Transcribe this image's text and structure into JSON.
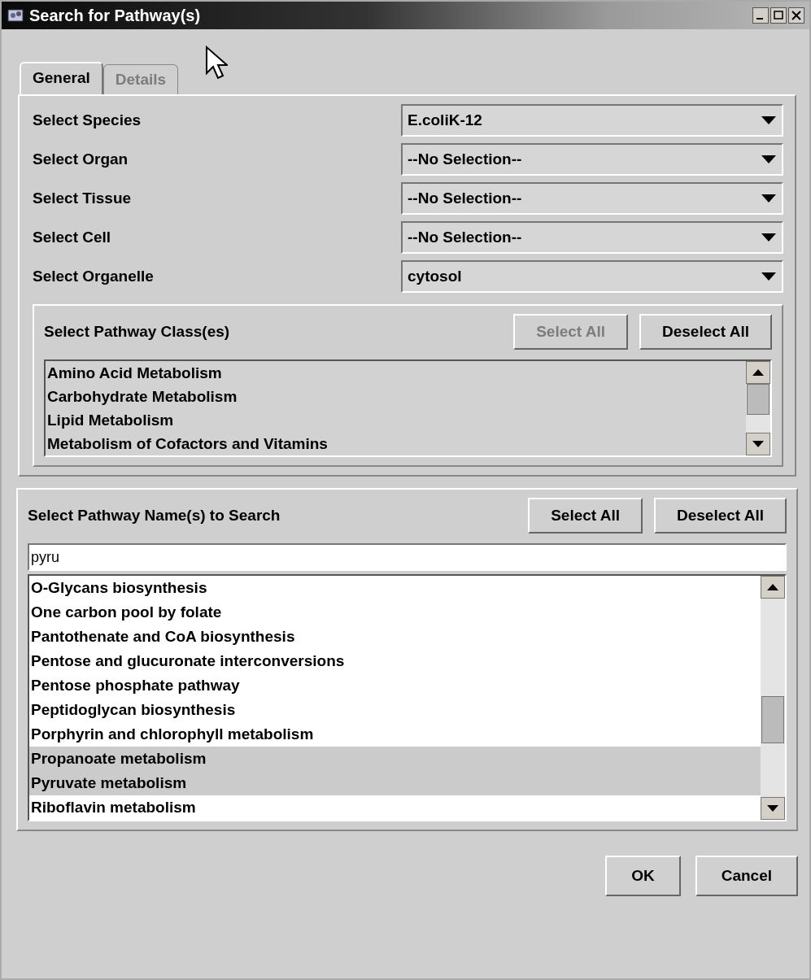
{
  "window": {
    "title": "Search for Pathway(s)"
  },
  "tabs": [
    {
      "label": "General",
      "selected": true,
      "disabled": false
    },
    {
      "label": "Details",
      "selected": false,
      "disabled": true
    }
  ],
  "selectors": [
    {
      "label": "Select Species",
      "value": "E.coliK-12"
    },
    {
      "label": "Select Organ",
      "value": "--No Selection--"
    },
    {
      "label": "Select Tissue",
      "value": "--No Selection--"
    },
    {
      "label": "Select Cell",
      "value": "--No Selection--"
    },
    {
      "label": "Select Organelle",
      "value": "cytosol"
    }
  ],
  "class_panel": {
    "label": "Select Pathway Class(es)",
    "buttons": [
      {
        "label": "Select All",
        "disabled": true
      },
      {
        "label": "Deselect All",
        "disabled": false
      }
    ],
    "items": [
      {
        "label": "Amino Acid Metabolism"
      },
      {
        "label": "Carbohydrate Metabolism"
      },
      {
        "label": "Lipid Metabolism"
      },
      {
        "label": "Metabolism of Cofactors and Vitamins"
      }
    ]
  },
  "name_panel": {
    "label": "Select Pathway Name(s) to Search",
    "buttons": [
      {
        "label": "Select All",
        "disabled": false
      },
      {
        "label": "Deselect All",
        "disabled": false
      }
    ],
    "filter": {
      "value": "pyru"
    },
    "items": [
      {
        "label": "O-Glycans biosynthesis",
        "selected": false
      },
      {
        "label": "One carbon pool by folate",
        "selected": false
      },
      {
        "label": "Pantothenate and CoA biosynthesis",
        "selected": false
      },
      {
        "label": "Pentose and glucuronate interconversions",
        "selected": false
      },
      {
        "label": "Pentose phosphate pathway",
        "selected": false
      },
      {
        "label": "Peptidoglycan biosynthesis",
        "selected": false
      },
      {
        "label": "Porphyrin and chlorophyll metabolism",
        "selected": false
      },
      {
        "label": "Propanoate metabolism",
        "selected": true
      },
      {
        "label": "Pyruvate metabolism",
        "selected": true
      },
      {
        "label": "Riboflavin metabolism",
        "selected": false
      }
    ]
  },
  "buttons": [
    {
      "label": "OK"
    },
    {
      "label": "Cancel"
    }
  ]
}
